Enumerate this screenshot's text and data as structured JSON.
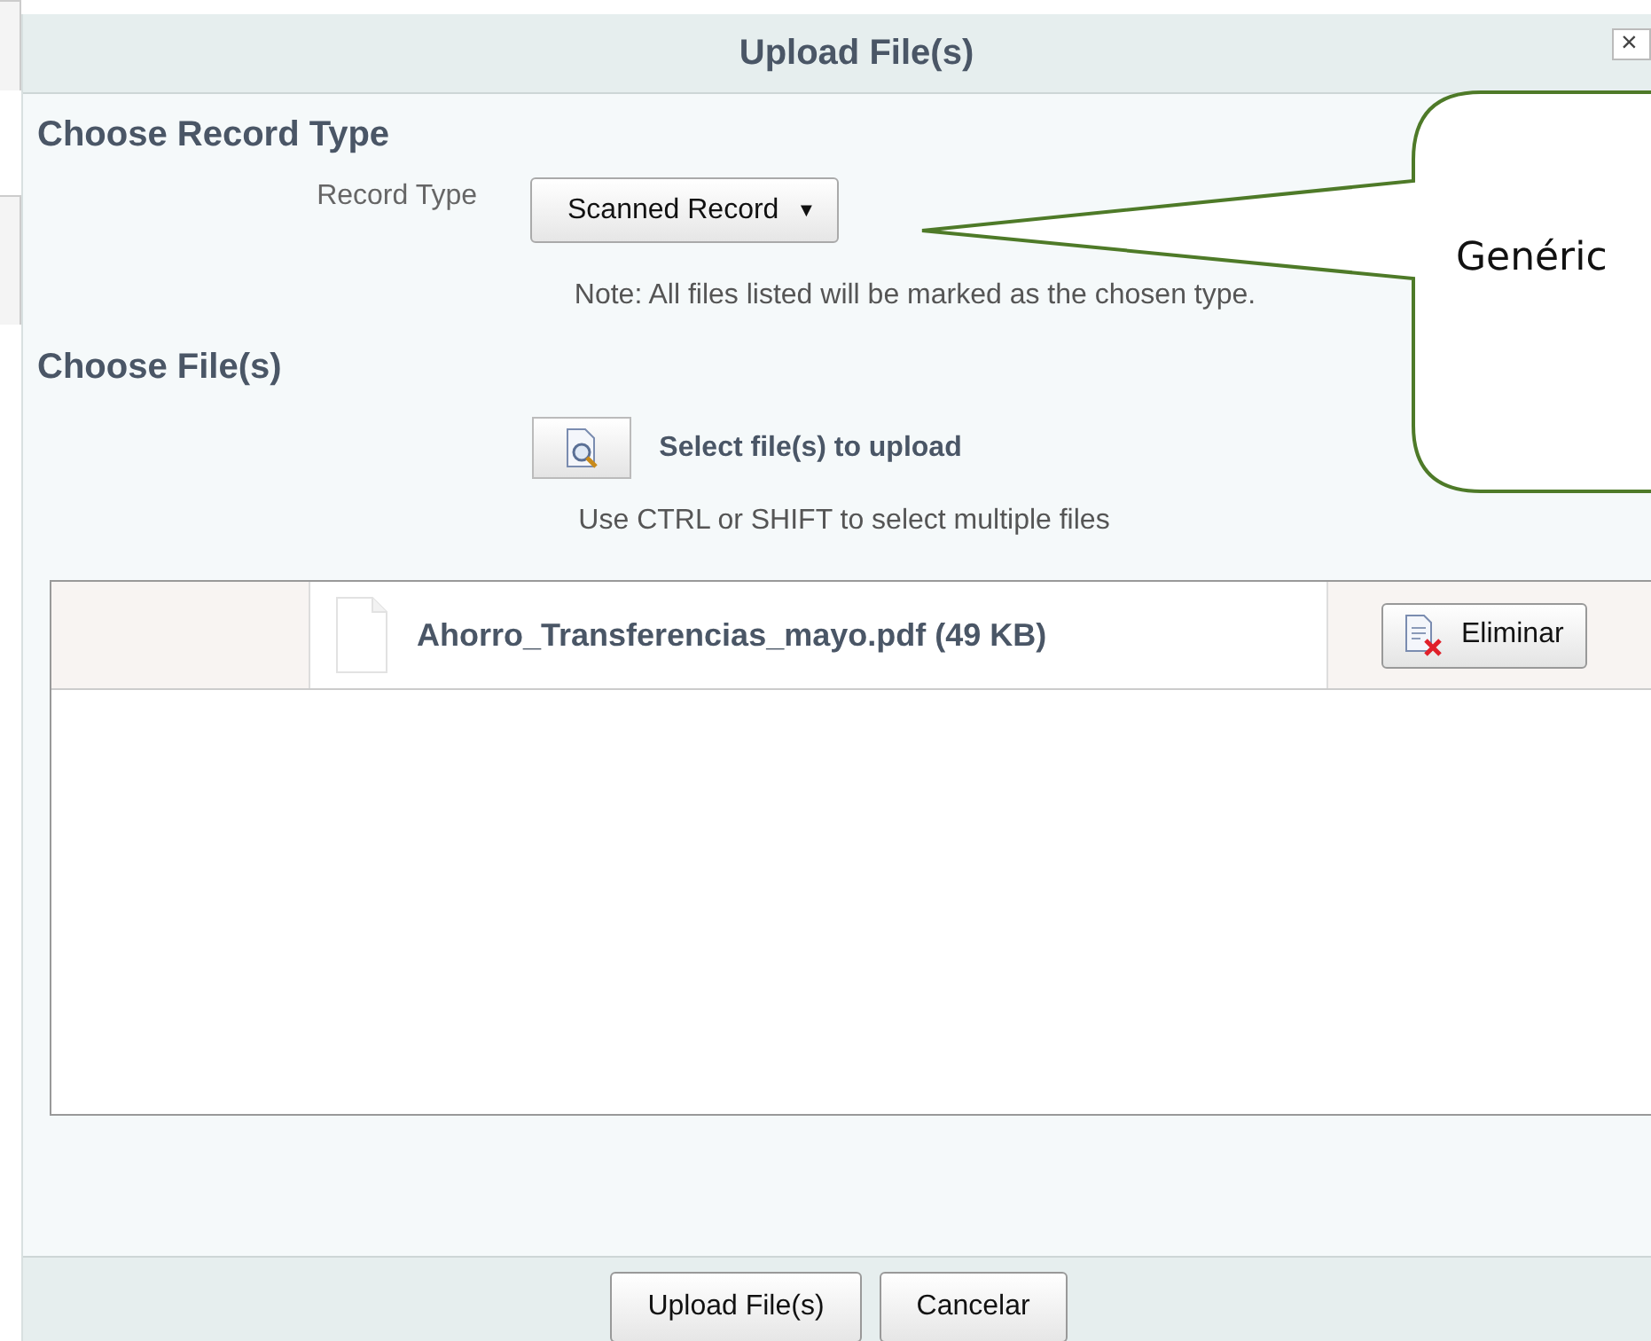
{
  "dialog": {
    "title": "Upload File(s)",
    "close": "×"
  },
  "record_section": {
    "heading": "Choose Record Type",
    "label": "Record Type",
    "dropdown": "Scanned Record",
    "caret": "▼",
    "note": "Note: All files listed will be marked as the chosen type."
  },
  "file_section": {
    "heading": "Choose File(s)",
    "select_label": "Select file(s) to upload",
    "hint": "Use CTRL or SHIFT to select multiple files"
  },
  "files": [
    {
      "name": "Ahorro_Transferencias_mayo.pdf (49 KB)",
      "remove": "Eliminar"
    }
  ],
  "buttons": [
    {
      "label": "Upload File(s)"
    },
    {
      "label": "Cancelar"
    }
  ],
  "callout": {
    "text": "Genéric"
  }
}
